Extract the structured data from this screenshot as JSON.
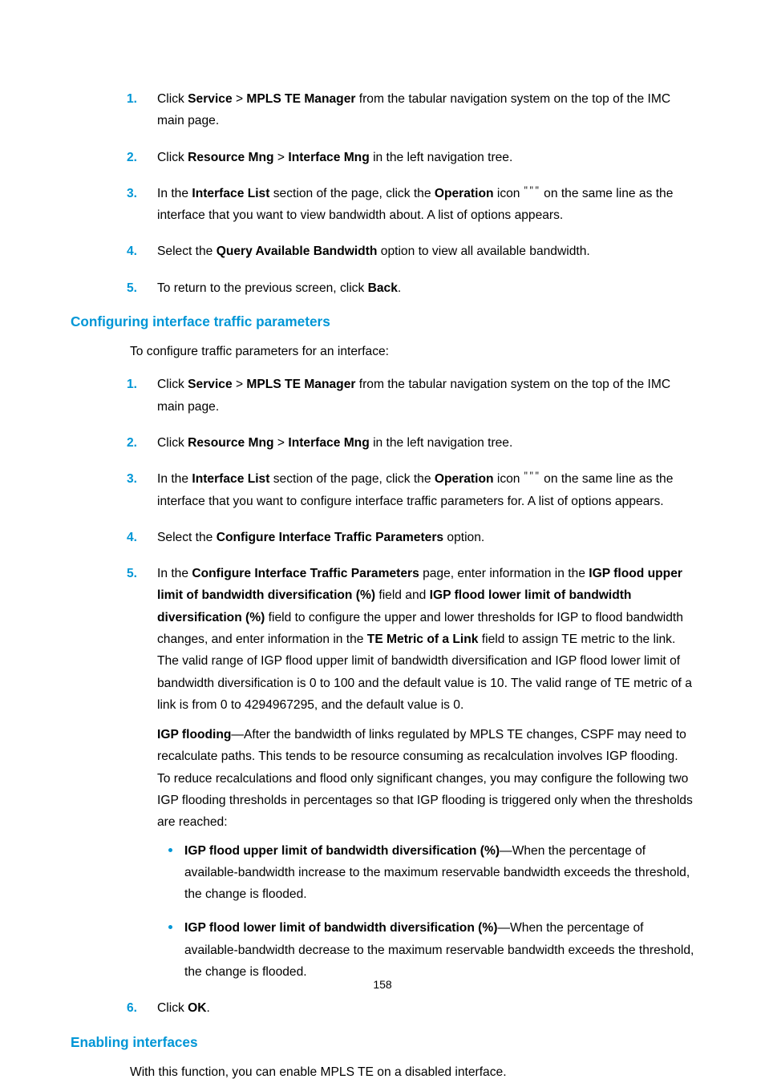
{
  "steps1": {
    "s1": {
      "n": "1.",
      "pre": "Click ",
      "b1": "Service",
      "gt": " > ",
      "b2": "MPLS TE Manager",
      "post": " from the tabular navigation system on the top of the IMC main page."
    },
    "s2": {
      "n": "2.",
      "pre": "Click ",
      "b1": "Resource Mng",
      "gt": " > ",
      "b2": "Interface Mng",
      "post": " in the left navigation tree."
    },
    "s3": {
      "n": "3.",
      "pre": "In the ",
      "b1": "Interface List",
      "mid": " section of the page, click the ",
      "b2": "Operation",
      "mid2": " icon ",
      "icon": "\"\"\"",
      "post": " on the same line as the interface that you want to view bandwidth about. A list of options appears."
    },
    "s4": {
      "n": "4.",
      "pre": "Select the ",
      "b1": "Query Available Bandwidth",
      "post": " option to view all available bandwidth."
    },
    "s5": {
      "n": "5.",
      "pre": "To return to the previous screen, click ",
      "b1": "Back",
      "post": "."
    }
  },
  "h1": "Configuring interface traffic parameters",
  "intro1": "To configure traffic parameters for an interface:",
  "steps2": {
    "s1": {
      "n": "1.",
      "pre": "Click ",
      "b1": "Service",
      "gt": " > ",
      "b2": "MPLS TE Manager",
      "post": " from the tabular navigation system on the top of the IMC main page."
    },
    "s2": {
      "n": "2.",
      "pre": "Click ",
      "b1": "Resource Mng",
      "gt": " > ",
      "b2": "Interface Mng",
      "post": " in the left navigation tree."
    },
    "s3": {
      "n": "3.",
      "pre": "In the ",
      "b1": "Interface List",
      "mid": " section of the page, click the ",
      "b2": "Operation",
      "mid2": " icon ",
      "icon": "\"\"\"",
      "post": " on the same line as the interface that you want to configure interface traffic parameters for. A list of options appears."
    },
    "s4": {
      "n": "4.",
      "pre": "Select the ",
      "b1": "Configure Interface Traffic Parameters",
      "post": " option."
    },
    "s5": {
      "n": "5.",
      "pre": "In the ",
      "b1": "Configure Interface Traffic Parameters",
      "mid": " page, enter information in the ",
      "b2": "IGP flood upper limit of bandwidth diversification (%)",
      "mid2": " field and ",
      "b3": "IGP flood lower limit of bandwidth diversification (%)",
      "mid3": " field to configure the upper and lower thresholds for IGP to flood bandwidth changes, and enter information in the ",
      "b4": "TE Metric of a Link",
      "post": " field to assign TE metric to the link. The valid range of IGP flood upper limit of bandwidth diversification and IGP flood lower limit of bandwidth diversification is 0 to 100 and the default value is 10. The valid range of TE metric of a link is from 0 to 4294967295, and the default value is 0.",
      "igpb": "IGP flooding",
      "igp": "—After the bandwidth of links regulated by MPLS TE changes, CSPF may need to recalculate paths. This tends to be resource consuming as recalculation involves IGP flooding. To reduce recalculations and flood only significant changes, you may configure the following two IGP flooding thresholds in percentages so that IGP flooding is triggered only when the thresholds are reached:",
      "bul1b": "IGP flood upper limit of bandwidth diversification (%)",
      "bul1": "—When the percentage of available-bandwidth increase to the maximum reservable bandwidth exceeds the threshold, the change is flooded.",
      "bul2b": "IGP flood lower limit of bandwidth diversification (%)",
      "bul2": "—When the percentage of available-bandwidth decrease to the maximum reservable bandwidth exceeds the threshold, the change is flooded."
    },
    "s6": {
      "n": "6.",
      "pre": "Click ",
      "b1": "OK",
      "post": "."
    }
  },
  "h2": "Enabling interfaces",
  "intro2": "With this function, you can enable MPLS TE on a disabled interface.",
  "pno": "158"
}
